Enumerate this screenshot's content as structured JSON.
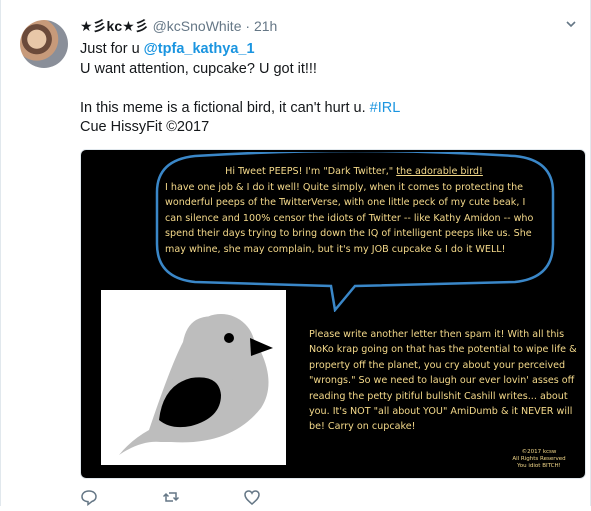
{
  "tweet": {
    "display_name": "★彡kc★彡",
    "handle": "@kcSnoWhite",
    "separator": "·",
    "time": "21h",
    "text": {
      "line1_prefix": "Just for u ",
      "mention": "@tpfa_kathya_1",
      "line2": "U want attention, cupcake? U got it!!!",
      "line3_prefix": "In this meme is a fictional bird, it can't hurt u. ",
      "hashtag": "#IRL",
      "line4": "Cue HissyFit ©2017"
    }
  },
  "meme": {
    "bubble_line1_prefix": "Hi Tweet PEEPS! I'm \"Dark Twitter,\" ",
    "bubble_line1_underlined": "the adorable bird!",
    "bubble_body": "I have one job & I do it well! Quite simply, when it comes to protecting the wonderful peeps of the TwitterVerse, with one little peck of my cute beak, I can silence and 100% censor the idiots of Twitter -- like Kathy Amidon -- who spend their days trying to bring down the IQ of intelligent peeps like us. She may whine, she may complain, but it's my JOB cupcake & I do it WELL!",
    "side_text": "Please write another letter then spam it! With all this NoKo krap going on that has the potential to wipe life & property off the planet, you cry about your perceived \"wrongs.\" So we need to laugh our ever lovin' asses off reading the petty pitiful bullshit Cashill writes... about you. It's NOT \"all about YOU\" AmiDumb & it NEVER will be! Carry on cupcake!",
    "copyright_1": "©2017 kcsw",
    "copyright_2": "All Rights Reserved",
    "copyright_3": "You idiot BITCH!",
    "colors": {
      "text": "#f4d98a",
      "bubble_border": "#3a87c8",
      "bird_body": "#bdbdbd",
      "bird_wing": "#000000",
      "background": "#000000"
    }
  },
  "actions": {
    "icons": [
      "reply-icon",
      "retweet-icon",
      "like-icon"
    ]
  },
  "colors": {
    "link": "#1b95e0",
    "secondary": "#657786"
  }
}
